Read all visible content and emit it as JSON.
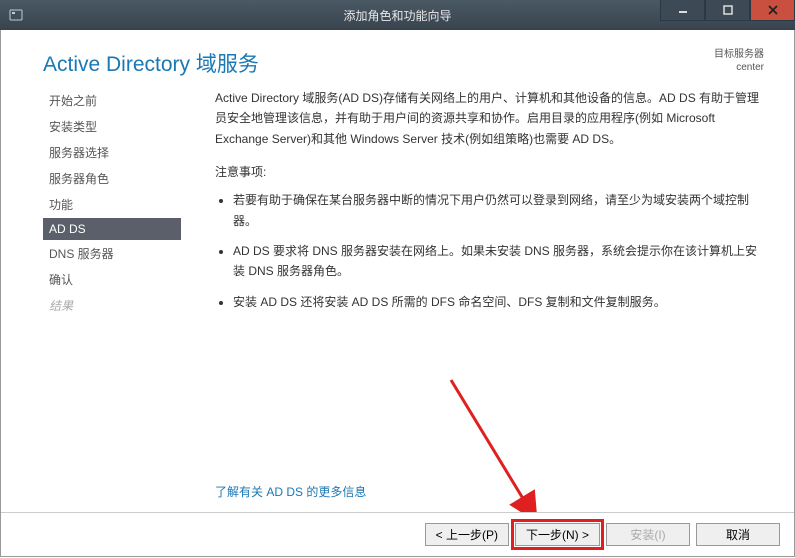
{
  "titlebar": {
    "title": "添加角色和功能向导"
  },
  "header": {
    "page_title": "Active Directory 域服务",
    "target_label": "目标服务器",
    "target_name": "center"
  },
  "sidebar": {
    "items": [
      {
        "label": "开始之前",
        "active": false
      },
      {
        "label": "安装类型",
        "active": false
      },
      {
        "label": "服务器选择",
        "active": false
      },
      {
        "label": "服务器角色",
        "active": false
      },
      {
        "label": "功能",
        "active": false
      },
      {
        "label": "AD DS",
        "active": true
      },
      {
        "label": "DNS 服务器",
        "active": false
      },
      {
        "label": "确认",
        "active": false
      },
      {
        "label": "结果",
        "active": false,
        "disabled": true
      }
    ]
  },
  "main": {
    "description": "Active Directory 域服务(AD DS)存储有关网络上的用户、计算机和其他设备的信息。AD DS 有助于管理员安全地管理该信息，并有助于用户间的资源共享和协作。启用目录的应用程序(例如 Microsoft Exchange Server)和其他 Windows Server 技术(例如组策略)也需要 AD DS。",
    "notes_label": "注意事项:",
    "notes": [
      "若要有助于确保在某台服务器中断的情况下用户仍然可以登录到网络，请至少为域安装两个域控制器。",
      "AD DS 要求将 DNS 服务器安装在网络上。如果未安装 DNS 服务器，系统会提示你在该计算机上安装 DNS 服务器角色。",
      "安装 AD DS 还将安装 AD DS 所需的 DFS 命名空间、DFS 复制和文件复制服务。"
    ],
    "more_link": "了解有关 AD DS 的更多信息"
  },
  "buttons": {
    "previous": "< 上一步(P)",
    "next": "下一步(N) >",
    "install": "安装(I)",
    "cancel": "取消"
  }
}
